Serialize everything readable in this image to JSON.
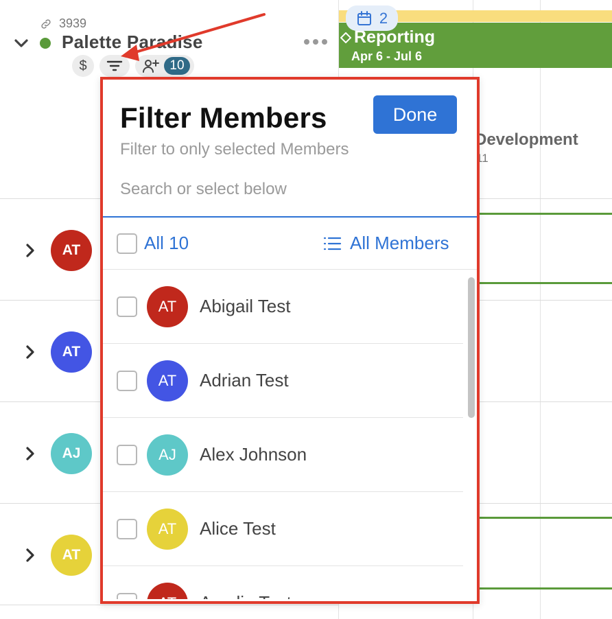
{
  "project": {
    "id": "3939",
    "name": "Palette Paradise",
    "member_count": "10",
    "dollar_symbol": "$"
  },
  "left_rows": [
    {
      "initials": "AT",
      "color": "#c0281c"
    },
    {
      "initials": "AT",
      "color": "#4355e4"
    },
    {
      "initials": "AJ",
      "color": "#5ec8c8"
    },
    {
      "initials": "AT",
      "color": "#e6d23a"
    }
  ],
  "timeline": {
    "calendar_count": "2",
    "phase_title": "Reporting",
    "phase_dates": "Apr 6 - Jul 6",
    "dev_title": "Development",
    "dev_sub": "11"
  },
  "filter": {
    "title": "Filter Members",
    "done_label": "Done",
    "subtitle": "Filter to only selected Members",
    "search_placeholder": "Search or select below",
    "all_label": "All 10",
    "all_members_label": "All Members",
    "members": [
      {
        "initials": "AT",
        "name": "Abigail Test",
        "color": "#c0281c",
        "checked": false
      },
      {
        "initials": "AT",
        "name": "Adrian Test",
        "color": "#4355e4",
        "checked": false
      },
      {
        "initials": "AJ",
        "name": "Alex Johnson",
        "color": "#5ec8c8",
        "checked": false
      },
      {
        "initials": "AT",
        "name": "Alice Test",
        "color": "#e6d23a",
        "checked": false
      },
      {
        "initials": "AT",
        "name": "Amelia Test",
        "color": "#c0281c",
        "checked": false
      }
    ]
  },
  "colors": {
    "accent_blue": "#2f73d5",
    "project_green": "#5a9a3a",
    "annotation_red": "#e03a2b",
    "highlight_yellow": "#f9dd7e"
  },
  "icons": [
    "link-icon",
    "chevron-down-icon",
    "dollar-icon",
    "filter-icon",
    "add-member-icon",
    "more-icon",
    "calendar-icon",
    "diamond-icon",
    "list-icon",
    "chevron-right-icon"
  ]
}
